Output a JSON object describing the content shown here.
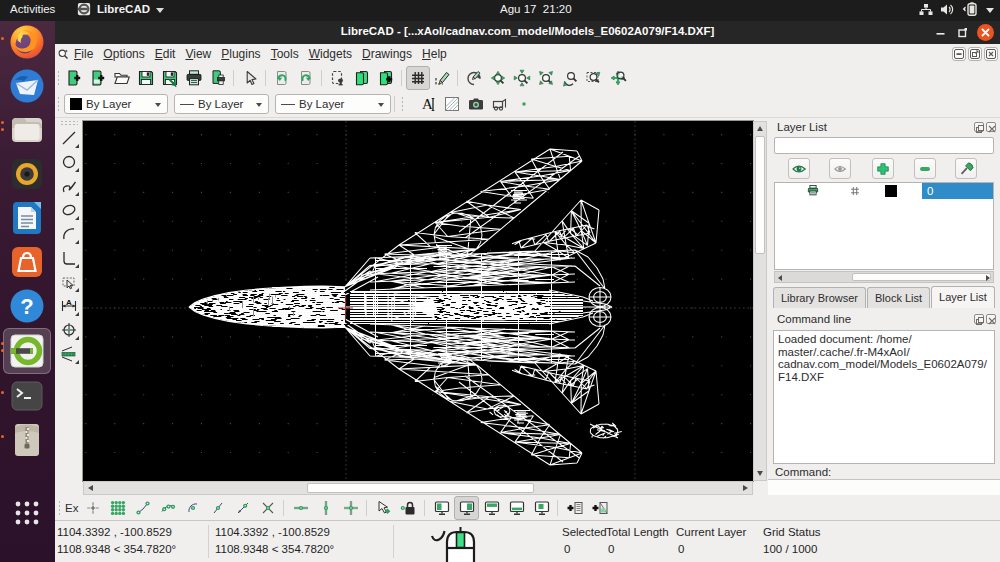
{
  "topbar": {
    "activities": "Activities",
    "app_name": "LibreCAD",
    "clock": "Agu 17  21:20"
  },
  "dock": {
    "items": [
      "firefox",
      "thunderbird",
      "files",
      "rhythmbox",
      "libreoffice-writer",
      "ubuntu-software",
      "help",
      "librecad",
      "terminal",
      "archive-manager",
      "show-applications"
    ],
    "active_item": "librecad"
  },
  "window": {
    "title": "LibreCAD - [...xAoI/cadnav.com_model/Models_E0602A079/F14.DXF]"
  },
  "menubar": {
    "items": [
      "File",
      "Options",
      "Edit",
      "View",
      "Plugins",
      "Tools",
      "Widgets",
      "Drawings",
      "Help"
    ]
  },
  "pen": {
    "color": "By Layer",
    "linetype": "By Layer",
    "width": "By Layer"
  },
  "layer_list": {
    "title": "Layer List",
    "filter_value": "",
    "layers": [
      {
        "name": "0",
        "visible": true,
        "print": true,
        "construction": false,
        "color": "#000000",
        "selected": true
      }
    ]
  },
  "dock_tabs": [
    "Library Browser",
    "Block List",
    "Layer List"
  ],
  "command": {
    "title": "Command line",
    "history_lines": [
      "Loaded document: /home/",
      "master/.cache/.fr-M4xAoI/",
      "cadnav.com_model/Models_E0602A079/",
      "F14.DXF"
    ],
    "prompt": "Command:",
    "input_value": ""
  },
  "snapbar": {
    "ex_label": "Ex"
  },
  "statusbar": {
    "coord1_line1": "1104.3392 , -100.8529",
    "coord1_line2": "1108.9348 < 354.7820°",
    "coord2_line1": "1104.3392 , -100.8529",
    "coord2_line2": "1108.9348 < 354.7820°",
    "selected_label": "Selected",
    "selected_value": "0",
    "total_length_label": "Total Length",
    "total_length_value": "0",
    "current_layer_label": "Current Layer",
    "current_layer_value": "0",
    "grid_status_label": "Grid Status",
    "grid_status_value": "100 / 1000"
  },
  "colors": {
    "selection_blue": "#308cc8",
    "icon_green": "#36a764",
    "ubuntu_orange": "#e9542f",
    "canvas_background": "#000000",
    "wireframe": "#ffffff"
  }
}
